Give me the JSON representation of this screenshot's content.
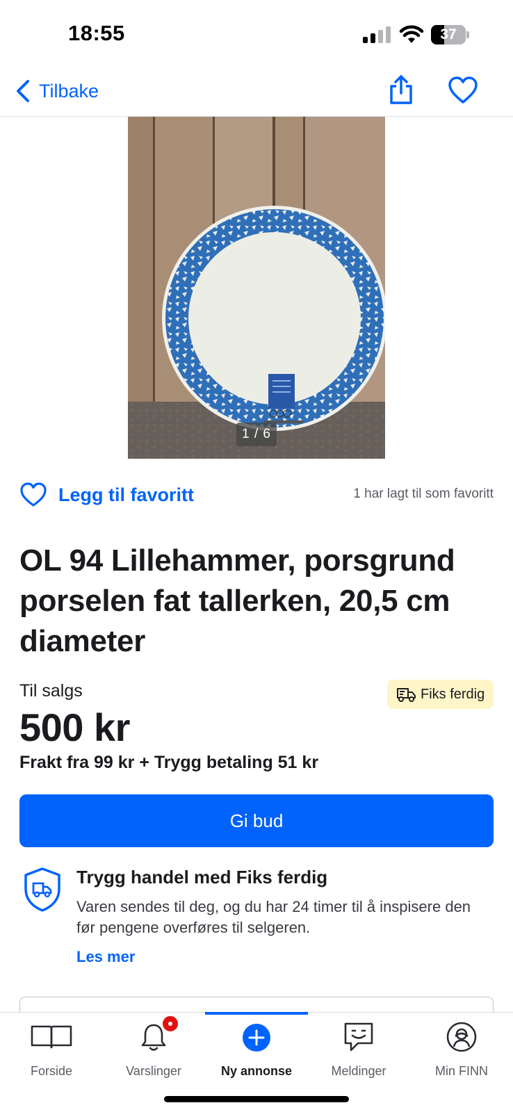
{
  "status_bar": {
    "time": "18:55",
    "battery": "37",
    "battery_level": 0.37,
    "icons": [
      "signal-icon",
      "wifi-icon",
      "battery-icon"
    ]
  },
  "nav": {
    "back_label": "Tilbake",
    "icons": [
      "chevron-left-icon",
      "share-icon",
      "heart-icon"
    ],
    "accent_color": "#0063fb"
  },
  "gallery": {
    "counter": "1 / 6"
  },
  "favorite": {
    "action_label": "Legg til favoritt",
    "count_text": "1 har lagt til som favoritt"
  },
  "listing": {
    "title": "OL 94 Lillehammer, porsgrund porselen fat tallerken, 20,5 cm diameter",
    "sale_label": "Til salgs",
    "badge_label": "Fiks ferdig",
    "price": "500 kr",
    "shipping": "Frakt fra 99 kr + Trygg betaling 51 kr",
    "bid_button": "Gi bud"
  },
  "trust": {
    "title": "Trygg handel med Fiks ferdig",
    "text": "Varen sendes til deg, og du har 24 timer til å inspisere den før pengene overføres til selgeren.",
    "link": "Les mer"
  },
  "tabs": [
    {
      "label": "Forside",
      "icon": "book-icon"
    },
    {
      "label": "Varslinger",
      "icon": "bell-icon"
    },
    {
      "label": "Ny annonse",
      "icon": "plus-circle-icon",
      "active": true
    },
    {
      "label": "Meldinger",
      "icon": "chat-icon"
    },
    {
      "label": "Min FINN",
      "icon": "profile-icon"
    }
  ]
}
